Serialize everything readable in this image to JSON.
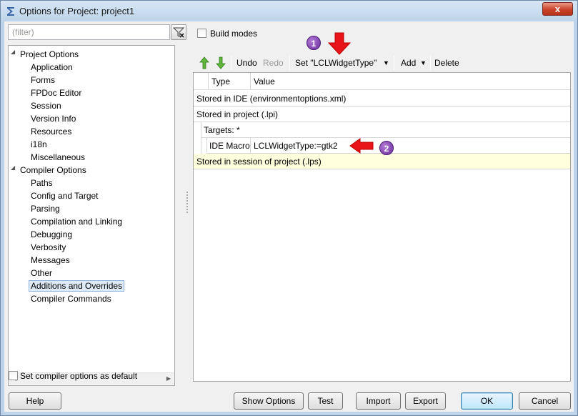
{
  "window": {
    "title": "Options for Project: project1",
    "close_label": "x"
  },
  "filter": {
    "placeholder": "(filter)"
  },
  "tree": {
    "project_options": {
      "label": "Project Options",
      "items": [
        "Application",
        "Forms",
        "FPDoc Editor",
        "Session",
        "Version Info",
        "Resources",
        "i18n",
        "Miscellaneous"
      ]
    },
    "compiler_options": {
      "label": "Compiler Options",
      "items": [
        "Paths",
        "Config and Target",
        "Parsing",
        "Compilation and Linking",
        "Debugging",
        "Verbosity",
        "Messages",
        "Other",
        "Additions and Overrides",
        "Compiler Commands"
      ]
    },
    "selected": "Additions and Overrides"
  },
  "build_modes": {
    "label": "Build modes",
    "checked": false
  },
  "toolbar": {
    "undo": "Undo",
    "redo": "Redo",
    "set": "Set \"LCLWidgetType\"",
    "add": "Add",
    "delete": "Delete"
  },
  "grid": {
    "columns": [
      "Type",
      "Value"
    ],
    "rows": [
      {
        "text": "Stored in IDE (environmentoptions.xml)"
      },
      {
        "text": "Stored in project (.lpi)"
      },
      {
        "text": "Targets: *"
      },
      {
        "type": "IDE Macro",
        "value": "LCLWidgetType:=gtk2"
      },
      {
        "text": "Stored in session of project (.lps)"
      }
    ]
  },
  "annotations": {
    "marker1": "1",
    "marker2": "2",
    "arrow_color": "#e8141a",
    "marker_color": "#7b3aa8"
  },
  "set_default": {
    "label": "Set compiler options as default",
    "checked": false
  },
  "buttons": {
    "help": "Help",
    "show_options": "Show Options",
    "test": "Test",
    "import": "Import",
    "export": "Export",
    "ok": "OK",
    "cancel": "Cancel"
  }
}
